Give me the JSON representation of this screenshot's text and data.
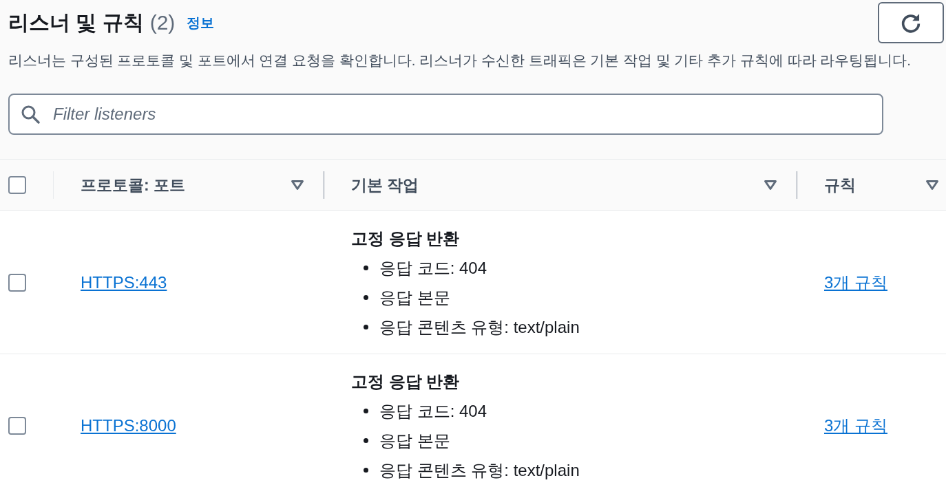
{
  "header": {
    "title": "리스너 및 규칙",
    "count": "(2)",
    "info_link": "정보",
    "description": "리스너는 구성된 프로토콜 및 포트에서 연결 요청을 확인합니다. 리스너가 수신한 트래픽은 기본 작업 및 기타 추가 규칙에 따라 라우팅됩니다."
  },
  "filter": {
    "placeholder": "Filter listeners"
  },
  "table": {
    "select_all": {
      "checked": false
    },
    "columns": [
      "프로토콜: 포트",
      "기본 작업",
      "규칙"
    ],
    "rows": [
      {
        "selected": false,
        "protocol_port": "HTTPS:443",
        "default_action": {
          "title": "고정 응답 반환",
          "details": [
            "응답 코드: 404",
            "응답 본문",
            "응답 콘텐츠 유형: text/plain"
          ]
        },
        "rules": "3개 규칙"
      },
      {
        "selected": false,
        "protocol_port": "HTTPS:8000",
        "default_action": {
          "title": "고정 응답 반환",
          "details": [
            "응답 코드: 404",
            "응답 본문",
            "응답 콘텐츠 유형: text/plain"
          ]
        },
        "rules": "3개 규칙"
      }
    ]
  }
}
